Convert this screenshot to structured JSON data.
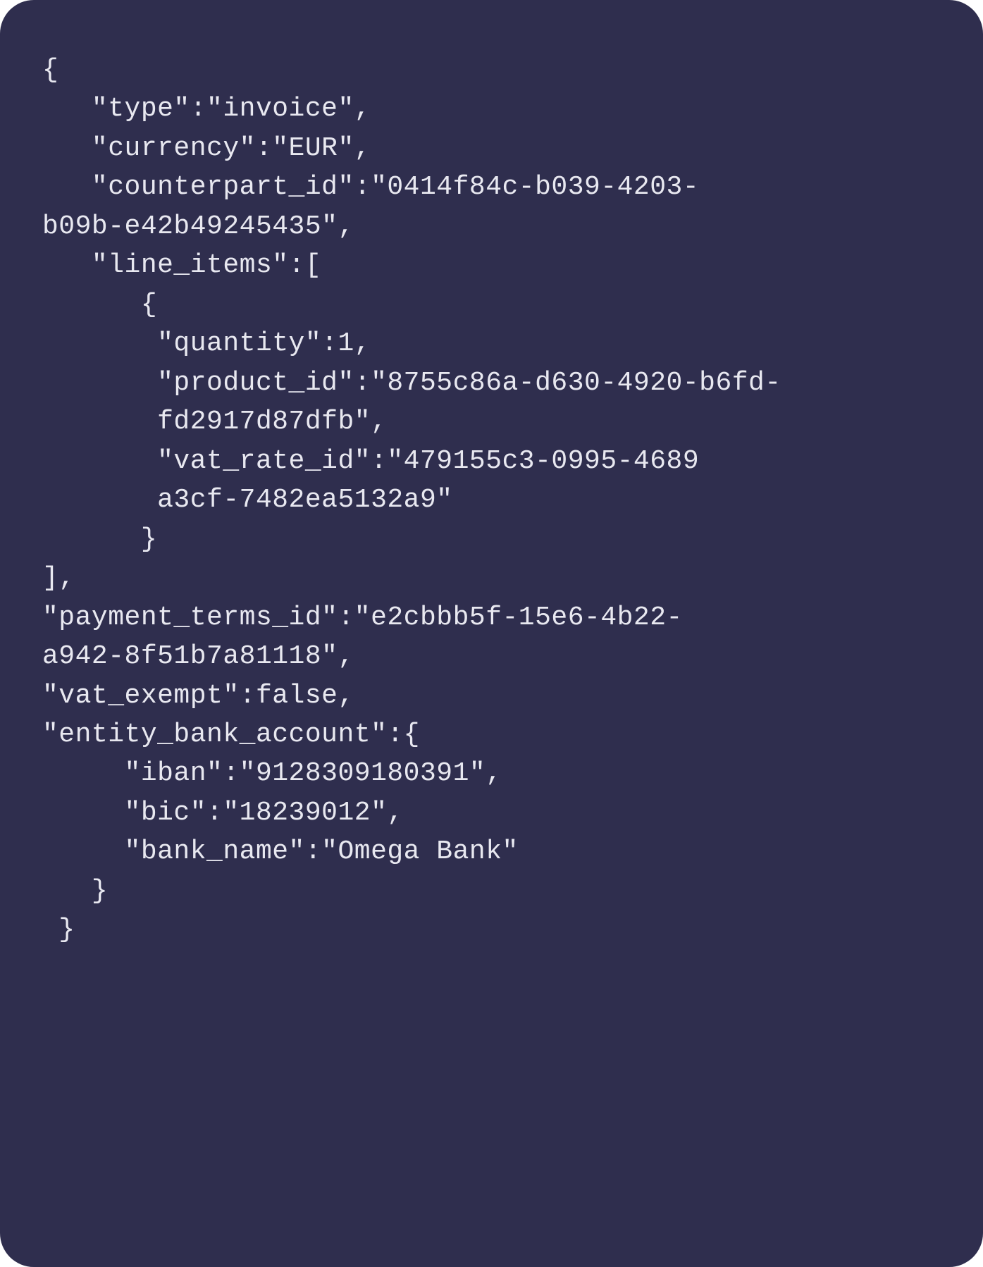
{
  "code": {
    "line1": "{",
    "line2": "   \"type\":\"invoice\",",
    "line3": "   \"currency\":\"EUR\",",
    "line4": "   \"counterpart_id\":\"0414f84c-b039-4203-",
    "line5": "b09b-e42b49245435\",",
    "line6": "   \"line_items\":[",
    "line7": "      {",
    "line8": "       \"quantity\":1,",
    "line9": "       \"product_id\":\"8755c86a-d630-4920-b6fd-",
    "line10": "       fd2917d87dfb\",",
    "line11": "       \"vat_rate_id\":\"479155c3-0995-4689",
    "line12": "       a3cf-7482ea5132a9\"",
    "line13": "      }",
    "line14": "],",
    "line15": "\"payment_terms_id\":\"e2cbbb5f-15e6-4b22-",
    "line16": "a942-8f51b7a81118\",",
    "line17": "\"vat_exempt\":false,",
    "line18": "\"entity_bank_account\":{",
    "line19": "     \"iban\":\"9128309180391\",",
    "line20": "     \"bic\":\"18239012\",",
    "line21": "     \"bank_name\":\"Omega Bank\"",
    "line22": "   }",
    "line23": " }"
  },
  "json_values": {
    "type": "invoice",
    "currency": "EUR",
    "counterpart_id": "0414f84c-b039-4203-b09b-e42b49245435",
    "line_items": [
      {
        "quantity": 1,
        "product_id": "8755c86a-d630-4920-b6fd-fd2917d87dfb",
        "vat_rate_id": "479155c3-0995-4689 a3cf-7482ea5132a9"
      }
    ],
    "payment_terms_id": "e2cbbb5f-15e6-4b22-a942-8f51b7a81118",
    "vat_exempt": false,
    "entity_bank_account": {
      "iban": "9128309180391",
      "bic": "18239012",
      "bank_name": "Omega Bank"
    }
  }
}
